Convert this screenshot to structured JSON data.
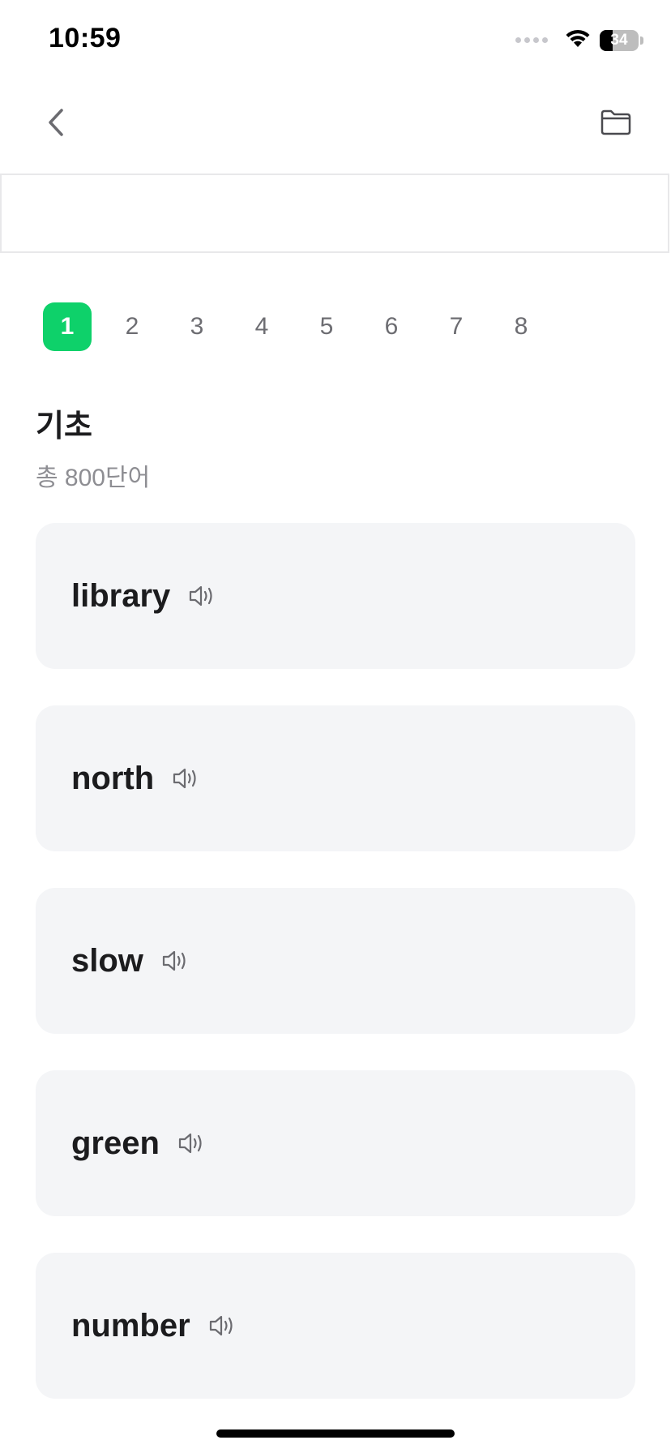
{
  "status_bar": {
    "time": "10:59",
    "battery_level": "34",
    "battery_fraction": 0.34
  },
  "nav": {
    "back_icon": "chevron-left-icon",
    "folder_icon": "folder-icon"
  },
  "levels": {
    "tabs": [
      "1",
      "2",
      "3",
      "4",
      "5",
      "6",
      "7",
      "8"
    ],
    "selected": "1",
    "accent_color": "#0ed16a"
  },
  "section": {
    "title": "기초",
    "count_label": "총 800단어"
  },
  "words": [
    {
      "word": "library"
    },
    {
      "word": "north"
    },
    {
      "word": "slow"
    },
    {
      "word": "green"
    },
    {
      "word": "number"
    }
  ],
  "icons": {
    "speaker": "speaker-icon"
  }
}
